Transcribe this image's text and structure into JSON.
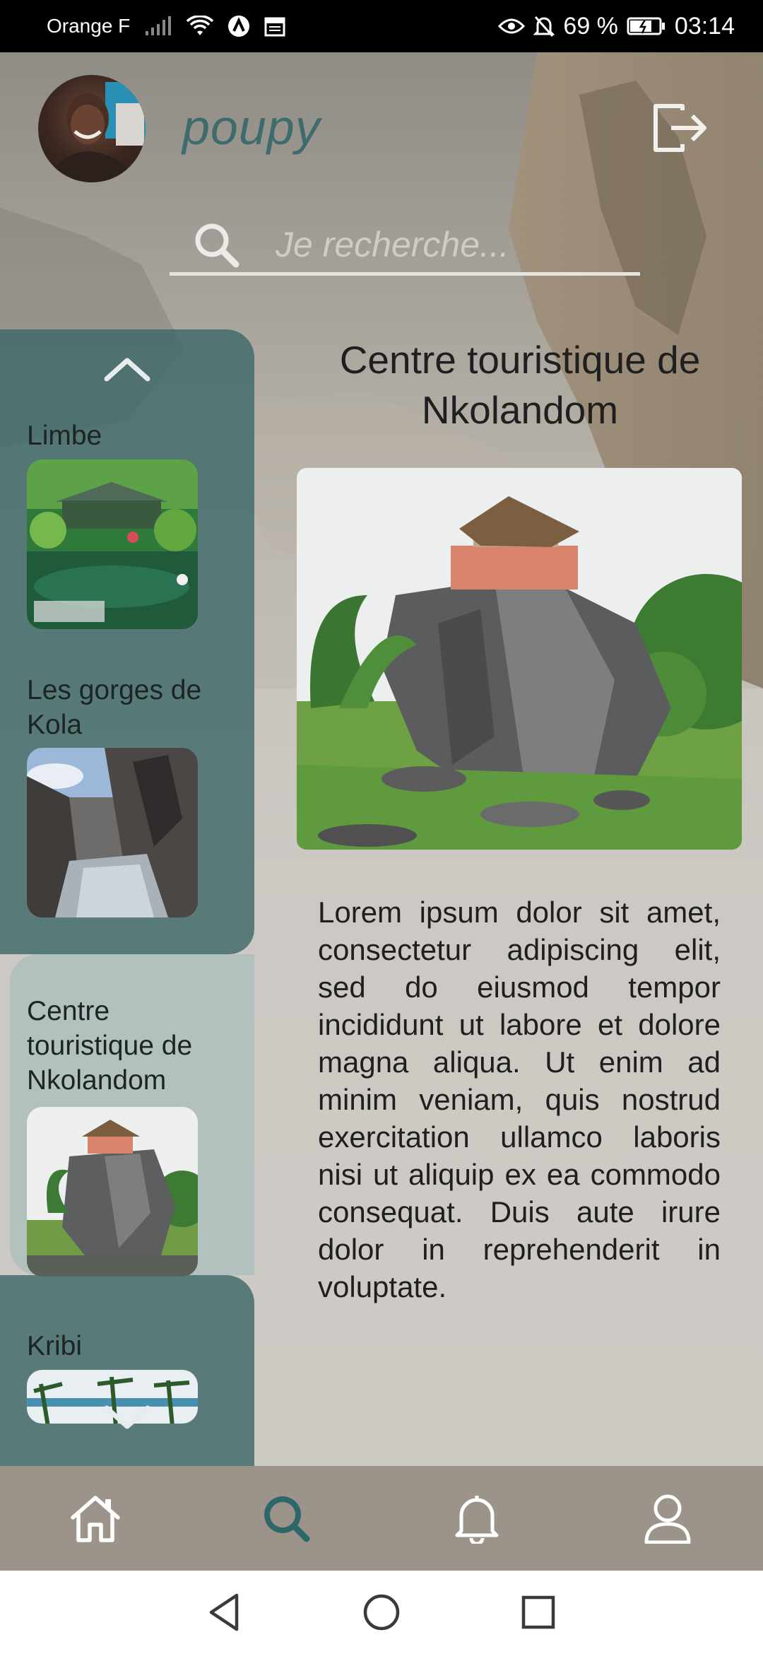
{
  "status_bar": {
    "carrier": "Orange F",
    "battery": "69 %",
    "time": "03:14"
  },
  "header": {
    "username": "poupy"
  },
  "search": {
    "placeholder": "Je recherche..."
  },
  "places": [
    {
      "name": "Limbe"
    },
    {
      "name": "Les gorges de Kola"
    },
    {
      "name": "Centre touristique de Nkolandom",
      "selected": true
    },
    {
      "name": "Kribi"
    }
  ],
  "detail": {
    "title": "Centre touristique de Nkolandom",
    "description": "Lorem ipsum dolor sit amet, consectetur adipiscing elit, sed do eiusmod tempor incididunt ut labore et dolore magna aliqua. Ut enim ad minim veniam, quis nostrud exercitation ullamco laboris nisi ut aliquip ex ea commodo consequat. Duis aute irure dolor in reprehenderit in voluptate."
  },
  "bottom_nav": {
    "items": [
      {
        "icon": "home-icon"
      },
      {
        "icon": "search-icon",
        "active": true
      },
      {
        "icon": "bell-icon"
      },
      {
        "icon": "user-icon"
      }
    ],
    "active_color": "#2f6768"
  },
  "colors": {
    "sidebar": "#3e6969",
    "selected_card": "#aabebc",
    "username": "#3e6b6c"
  }
}
